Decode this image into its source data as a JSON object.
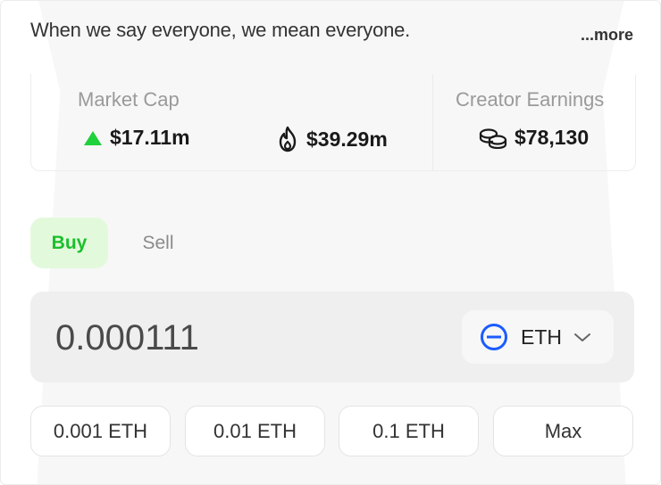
{
  "description": "When we say everyone, we mean everyone.",
  "more_label": "...more",
  "stats": {
    "market_cap_label": "Market Cap",
    "market_cap_value": "$17.11m",
    "volume_value": "$39.29m",
    "creator_earnings_label": "Creator Earnings",
    "creator_earnings_value": "$78,130",
    "up_color": "#1fd13a"
  },
  "tabs": {
    "buy_label": "Buy",
    "sell_label": "Sell",
    "active": "buy"
  },
  "amount": {
    "value": "0.000111",
    "token_label": "ETH",
    "token_icon": "eth-circle-icon",
    "token_color": "#1a5cff"
  },
  "presets": [
    {
      "label": "0.001 ETH"
    },
    {
      "label": "0.01 ETH"
    },
    {
      "label": "0.1 ETH"
    },
    {
      "label": "Max"
    }
  ]
}
